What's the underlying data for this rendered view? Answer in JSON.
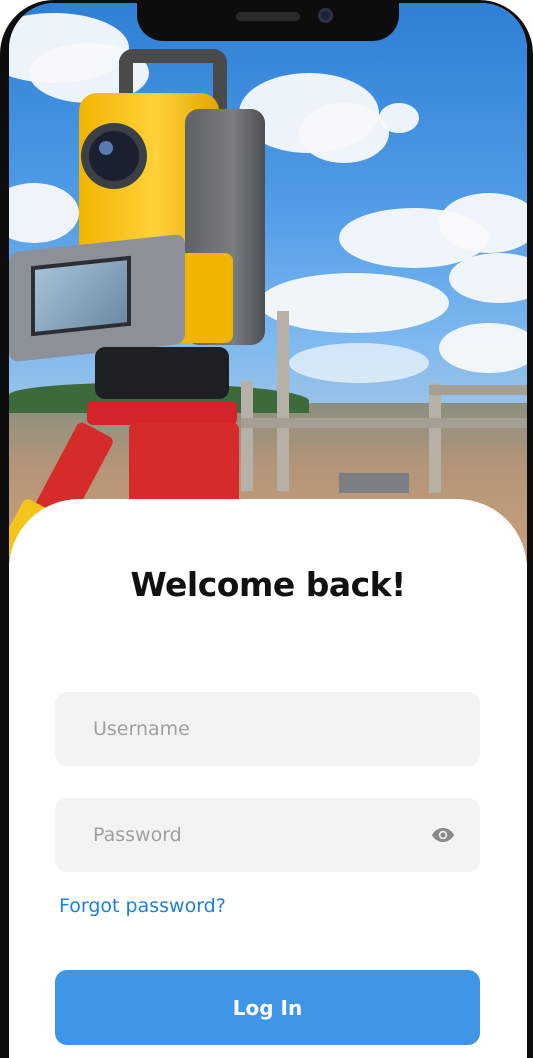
{
  "login": {
    "title": "Welcome back!",
    "username": {
      "placeholder": "Username",
      "value": ""
    },
    "password": {
      "placeholder": "Password",
      "value": ""
    },
    "password_toggle_icon": "eye-icon",
    "forgot_password_label": "Forgot password?",
    "login_button_label": "Log In"
  },
  "colors": {
    "accent": "#3f95e6",
    "link": "#1c83d8",
    "field_background": "#f3f3f3",
    "title_text": "#111111"
  }
}
